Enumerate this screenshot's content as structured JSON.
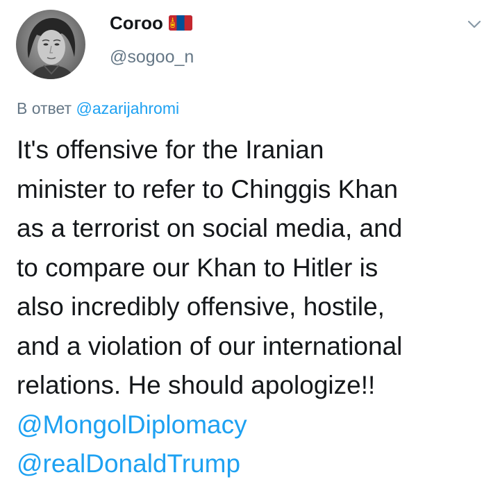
{
  "author": {
    "display_name": "Согоо",
    "flag_icon": "mongolia-flag-icon",
    "handle": "@sogoo_n",
    "avatar_icon": "profile-photo-grayscale"
  },
  "menu": {
    "icon": "chevron-down-icon"
  },
  "reply": {
    "prefix": "В ответ",
    "mention": "@azarijahromi"
  },
  "tweet": {
    "lines": [
      "It's offensive for the Iranian",
      "minister to refer to Chinggis Khan",
      "as a terrorist on social media, and",
      "to compare our Khan to Hitler is",
      "also incredibly offensive, hostile,",
      "and a violation of our international",
      "relations. He should apologize!!"
    ],
    "mentions": [
      "@MongolDiplomacy",
      "@realDonaldTrump"
    ]
  },
  "colors": {
    "text": "#14171a",
    "secondary": "#657786",
    "link": "#1da1f2",
    "flag_red": "#c4272f",
    "flag_blue": "#015197",
    "flag_gold": "#f9cf02"
  }
}
